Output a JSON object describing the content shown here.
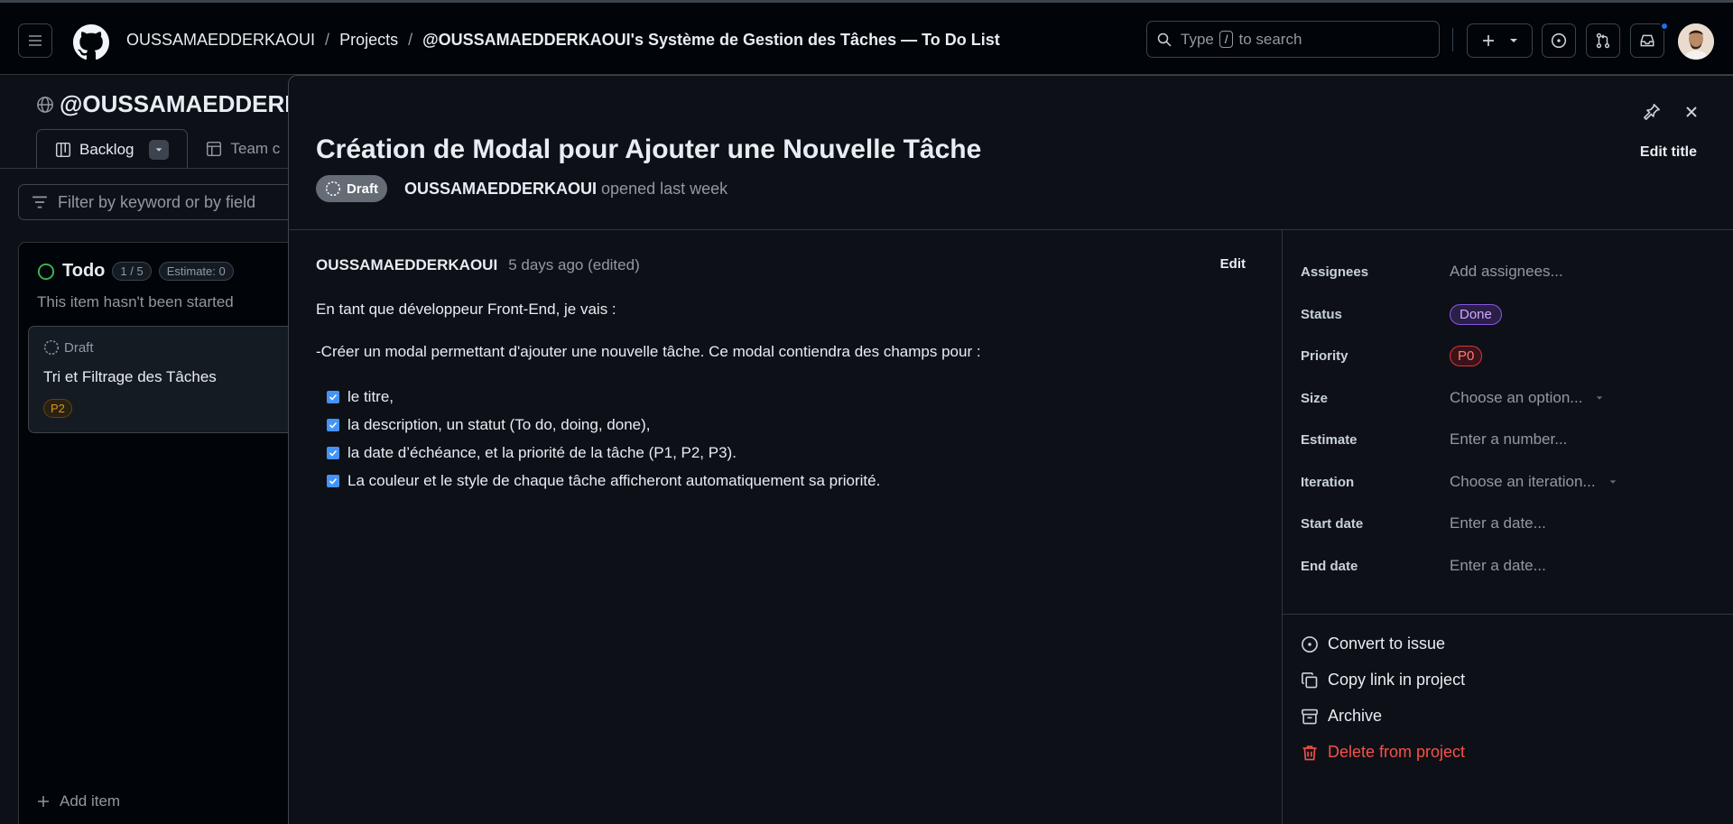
{
  "header": {
    "owner": "OUSSAMAEDDERKAOUI",
    "sep": "/",
    "projects": "Projects",
    "project": "@OUSSAMAEDDERKAOUI's Système de Gestion des Tâches — To Do List",
    "search": {
      "pre": "Type",
      "key": "/",
      "post": "to search"
    }
  },
  "background": {
    "title": "@OUSSAMAEDDERKAOUI",
    "tabs": [
      {
        "label": "Backlog"
      },
      {
        "label": "Team c"
      }
    ],
    "filter_placeholder": "Filter by keyword or by field",
    "column": {
      "name": "Todo",
      "count": "1 / 5",
      "estimate": "Estimate: 0",
      "description": "This item hasn't been started",
      "card": {
        "status": "Draft",
        "title": "Tri et Filtrage des Tâches",
        "priority": "P2"
      },
      "add_item": "Add item"
    }
  },
  "panel": {
    "title": "Création de Modal pour Ajouter une Nouvelle Tâche",
    "edit_title": "Edit title",
    "draft": "Draft",
    "author": "OUSSAMAEDDERKAOUI",
    "opened": "opened last week",
    "comment": {
      "author": "OUSSAMAEDDERKAOUI",
      "time": "5 days ago (edited)",
      "edit": "Edit",
      "paragraphs": [
        "En tant que développeur Front-End, je vais :",
        "-Créer un modal permettant d'ajouter une nouvelle tâche. Ce modal contiendra des champs pour :"
      ],
      "tasks": [
        "le titre,",
        "la description, un statut (To do, doing, done),",
        "la date d’échéance, et la priorité de la tâche (P1, P2, P3).",
        "La couleur et le style de chaque tâche afficheront automatiquement sa priorité."
      ]
    },
    "fields": [
      {
        "label": "Assignees",
        "value": "Add assignees..."
      },
      {
        "label": "Status",
        "value": "Done"
      },
      {
        "label": "Priority",
        "value": "P0"
      },
      {
        "label": "Size",
        "value": "Choose an option..."
      },
      {
        "label": "Estimate",
        "value": "Enter a number..."
      },
      {
        "label": "Iteration",
        "value": "Choose an iteration..."
      },
      {
        "label": "Start date",
        "value": "Enter a date..."
      },
      {
        "label": "End date",
        "value": "Enter a date..."
      }
    ],
    "actions": [
      {
        "label": "Convert to issue"
      },
      {
        "label": "Copy link in project"
      },
      {
        "label": "Archive"
      },
      {
        "label": "Delete from project"
      }
    ],
    "colors": {
      "accent": "#4493f8",
      "done": "#8957e5",
      "danger": "#f85149",
      "background": "#0d1117"
    }
  }
}
